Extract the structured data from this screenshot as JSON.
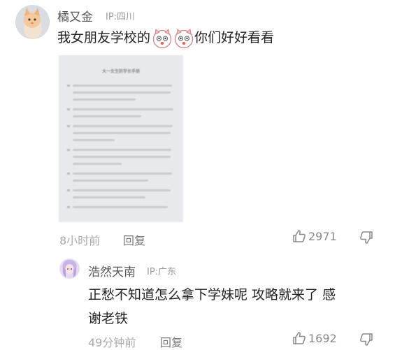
{
  "comment": {
    "username": "橘又金",
    "ip": "IP:四川",
    "text": "我女朋友学校的",
    "text_suffix": "你们好好看看",
    "attachment_title": "大一女生防学长手册",
    "time": "8小时前",
    "reply_label": "回复",
    "like_count": "2971"
  },
  "reply": {
    "username": "浩然天南",
    "ip": "IP:广东",
    "text_line1": "正愁不知道怎么拿下学妹呢 攻略就来了 感",
    "text_line2": "谢老铁",
    "time": "49分钟前",
    "reply_label": "回复",
    "like_count": "1692"
  }
}
